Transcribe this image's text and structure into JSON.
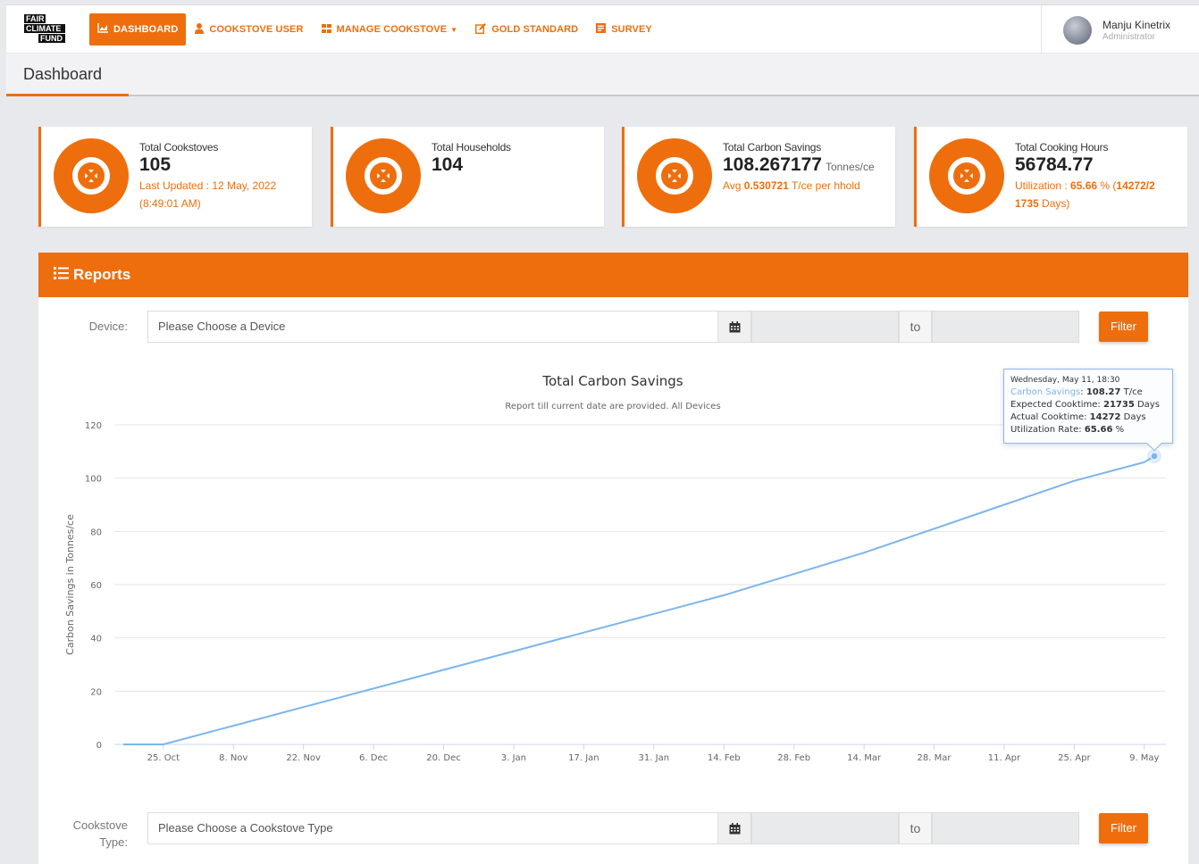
{
  "logo": {
    "line1": "FAIR",
    "line2": "CLIMATE",
    "line3": "FUND"
  },
  "nav": {
    "dashboard": "DASHBOARD",
    "cookstove_user": "COOKSTOVE USER",
    "manage_cookstove": "MANAGE COOKSTOVE",
    "gold_standard": "GOLD STANDARD",
    "survey": "SURVEY"
  },
  "user": {
    "name": "Manju Kinetrix",
    "role": "Administrator"
  },
  "page_title": "Dashboard",
  "cards": {
    "cookstoves": {
      "label": "Total Cookstoves",
      "value": "105",
      "sub1": "Last Updated : 12 May, 2022",
      "sub2": "(8:49:01 AM)"
    },
    "households": {
      "label": "Total Households",
      "value": "104"
    },
    "carbon": {
      "label": "Total Carbon Savings",
      "value": "108.267177",
      "unit": "Tonnes/ce",
      "avg_prefix": "Avg ",
      "avg_value": "0.530721",
      "avg_suffix": " T/ce per hhold"
    },
    "cooking": {
      "label": "Total Cooking Hours",
      "value": "56784.77",
      "util_prefix": "Utilization : ",
      "util_value": "65.66",
      "util_mid": " % (",
      "util_ratio": "14272/2",
      "util_days_value": "1735",
      "util_days_suffix": " Days)"
    }
  },
  "reports": {
    "title": "Reports",
    "device_label": "Device:",
    "device_placeholder": "Please Choose a Device",
    "to": "to",
    "filter": "Filter",
    "type_label_1": "Cookstove",
    "type_label_2": "Type:",
    "type_placeholder": "Please Choose a Cookstove Type"
  },
  "tooltip": {
    "date": "Wednesday, May 11, 18:30",
    "cs_label": "Carbon Savings",
    "cs_value": "108.27",
    "cs_unit": " T/ce",
    "exp_label": "Expected Cooktime: ",
    "exp_value": "21735",
    "act_label": "Actual Cooktime: ",
    "act_value": "14272",
    "days": " Days",
    "util_label": "Utilization Rate: ",
    "util_value": "65.66",
    "util_unit": " %"
  },
  "colors": {
    "accent": "#ee6e0d",
    "series": "#7cb5ec"
  },
  "chart_data": {
    "type": "line",
    "title": "Total Carbon Savings",
    "subtitle": "Report till current date are provided. All Devices",
    "ylabel": "Carbon Savings in Tonnes/ce",
    "xlabel": "",
    "ylim": [
      0,
      120
    ],
    "yticks": [
      0,
      20,
      40,
      60,
      80,
      100,
      120
    ],
    "x_tick_labels": [
      "25. Oct",
      "8. Nov",
      "22. Nov",
      "6. Dec",
      "20. Dec",
      "3. Jan",
      "17. Jan",
      "31. Jan",
      "14. Feb",
      "28. Feb",
      "14. Mar",
      "28. Mar",
      "11. Apr",
      "25. Apr",
      "9. May"
    ],
    "grid": true,
    "legend": "none",
    "series": [
      {
        "values": [
          {
            "x": "2021-10-17",
            "y": 0
          },
          {
            "x": "2021-10-25",
            "y": 0
          },
          {
            "x": "2021-11-08",
            "y": 7
          },
          {
            "x": "2021-11-22",
            "y": 14
          },
          {
            "x": "2021-12-06",
            "y": 21
          },
          {
            "x": "2021-12-20",
            "y": 28
          },
          {
            "x": "2022-01-03",
            "y": 35
          },
          {
            "x": "2022-01-17",
            "y": 42
          },
          {
            "x": "2022-01-31",
            "y": 49
          },
          {
            "x": "2022-02-14",
            "y": 56
          },
          {
            "x": "2022-02-28",
            "y": 64
          },
          {
            "x": "2022-03-14",
            "y": 72
          },
          {
            "x": "2022-03-28",
            "y": 81
          },
          {
            "x": "2022-04-11",
            "y": 90
          },
          {
            "x": "2022-04-25",
            "y": 99
          },
          {
            "x": "2022-05-09",
            "y": 106
          },
          {
            "x": "2022-05-11",
            "y": 108.27
          }
        ]
      }
    ]
  }
}
